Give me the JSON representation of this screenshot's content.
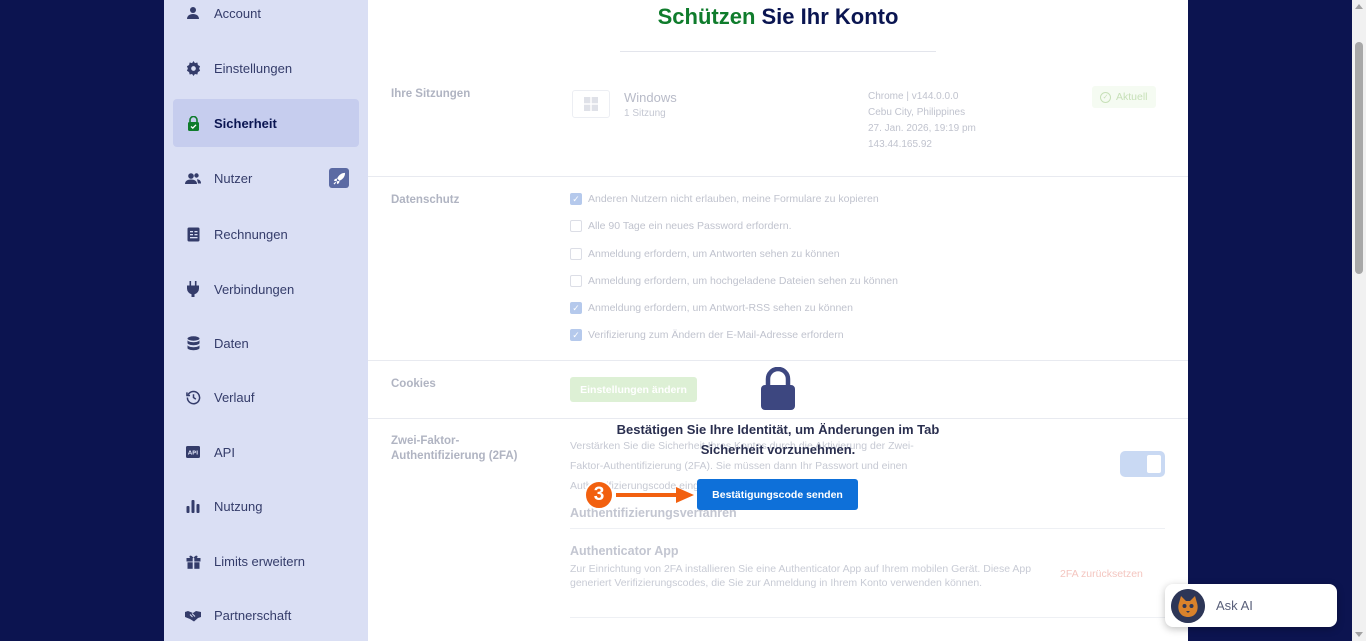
{
  "sidebar": {
    "items": [
      {
        "label": "Account",
        "icon": "user-icon"
      },
      {
        "label": "Einstellungen",
        "icon": "gear-icon"
      },
      {
        "label": "Sicherheit",
        "icon": "lock-icon",
        "active": true
      },
      {
        "label": "Nutzer",
        "icon": "users-icon",
        "badge_icon": "rocket-icon"
      },
      {
        "label": "Rechnungen",
        "icon": "invoice-icon"
      },
      {
        "label": "Verbindungen",
        "icon": "plug-icon"
      },
      {
        "label": "Daten",
        "icon": "database-icon"
      },
      {
        "label": "Verlauf",
        "icon": "history-icon"
      },
      {
        "label": "API",
        "icon": "api-icon"
      },
      {
        "label": "Nutzung",
        "icon": "bar-chart-icon"
      },
      {
        "label": "Limits erweitern",
        "icon": "gift-icon"
      },
      {
        "label": "Partnerschaft",
        "icon": "handshake-icon"
      }
    ]
  },
  "main": {
    "title_accent": "Schützen",
    "title_rest": " Sie Ihr Konto",
    "sessions": {
      "section_title": "Ihre Sitzungen",
      "device_name": "Windows",
      "device_sub": "1 Sitzung",
      "browser": "Chrome | v144.0.0.0",
      "location": "Cebu City, Philippines",
      "date": "27. Jan. 2026, 19:19 pm",
      "ip": "143.44.165.92",
      "current_badge": "Aktuell"
    },
    "privacy": {
      "section_title": "Datenschutz",
      "options": [
        {
          "label": "Anderen Nutzern nicht erlauben, meine Formulare zu kopieren",
          "checked": true
        },
        {
          "label": "Alle 90 Tage ein neues Password erfordern.",
          "checked": false
        },
        {
          "label": "Anmeldung erfordern, um Antworten sehen zu können",
          "checked": false
        },
        {
          "label": "Anmeldung erfordern, um hochgeladene Dateien sehen zu können",
          "checked": false
        },
        {
          "label": "Anmeldung erfordern, um Antwort-RSS sehen zu können",
          "checked": true
        },
        {
          "label": "Verifizierung zum Ändern der E-Mail-Adresse erfordern",
          "checked": true
        }
      ]
    },
    "cookies": {
      "section_title": "Cookies",
      "button_label": "Einstellungen ändern"
    },
    "two_factor": {
      "section_title_line1": "Zwei-Faktor-",
      "section_title_line2": "Authentifizierung (2FA)",
      "desc_line1": "Verstärken Sie die Sicherheit Ihres Kontos durch die Aktivierung der Zwei-",
      "desc_line2": "Faktor-Authentifizierung (2FA). Sie müssen dann Ihr Passwort und einen",
      "desc_line3": "Authentifizierungscode eingeben.",
      "toggle_on": true,
      "methods_title": "Authentifizierungsverfahren",
      "app_title": "Authenticator App",
      "app_desc": "Zur Einrichtung von 2FA installieren Sie eine Authenticator App auf Ihrem mobilen Gerät. Diese App generiert Verifizierungscodes, die Sie zur Anmeldung in Ihrem Konto verwenden können.",
      "reset_link": "2FA zurücksetzen"
    }
  },
  "overlay": {
    "message_line1": "Bestätigen Sie Ihre Identität, um Änderungen im Tab",
    "message_line2": "Sicherheit vorzunehmen.",
    "button_label": "Bestätigungscode senden",
    "step_number": "3"
  },
  "ask_ai": {
    "label": "Ask AI"
  },
  "colors": {
    "background": "#0c1450",
    "sidebar": "#dadff4",
    "accent_green": "#0f7c2c",
    "primary_blue": "#0e70d9",
    "step_orange": "#f2600f"
  }
}
